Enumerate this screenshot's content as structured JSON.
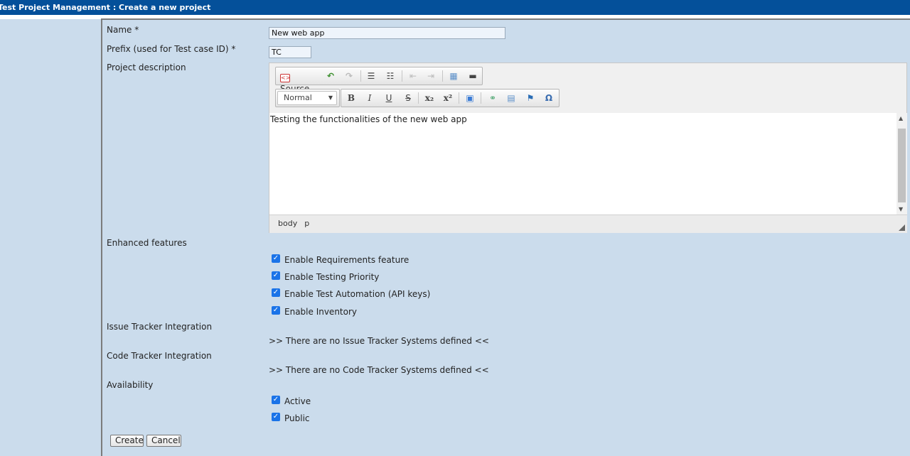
{
  "header": {
    "title": "Test Project Management : Create a new project"
  },
  "form": {
    "name_label": "Name *",
    "name_value": "New web app",
    "prefix_label": "Prefix (used for Test case ID) *",
    "prefix_value": "TC",
    "description_label": "Project description",
    "enhanced_label": "Enhanced features",
    "issue_label": "Issue Tracker Integration",
    "issue_info": ">> There are no Issue Tracker Systems defined <<",
    "code_label": "Code Tracker Integration",
    "code_info": ">> There are no Code Tracker Systems defined <<",
    "availability_label": "Availability",
    "create_label": "Create",
    "cancel_label": "Cancel"
  },
  "editor": {
    "source_label": "Source",
    "format_value": "Normal",
    "content": "Testing the functionalities of the new web app",
    "path": [
      "body",
      "p"
    ],
    "toolbar_icons": [
      "source-icon",
      "undo-icon",
      "redo-icon",
      "numbered-list-icon",
      "bullet-list-icon",
      "outdent-icon",
      "indent-icon",
      "table-icon",
      "horizontal-rule-icon",
      "bold-icon",
      "italic-icon",
      "underline-icon",
      "strikethrough-icon",
      "subscript-icon",
      "superscript-icon",
      "image-icon",
      "link-icon",
      "unlink-icon",
      "anchor-icon",
      "special-char-icon"
    ]
  },
  "enhanced_features": [
    {
      "label": "Enable Requirements feature",
      "checked": true
    },
    {
      "label": "Enable Testing Priority",
      "checked": true
    },
    {
      "label": "Enable Test Automation (API keys)",
      "checked": true
    },
    {
      "label": "Enable Inventory",
      "checked": true
    }
  ],
  "availability": [
    {
      "label": "Active",
      "checked": true
    },
    {
      "label": "Public",
      "checked": true
    }
  ],
  "colors": {
    "header_bg": "#04509a",
    "page_bg": "#cbdcec",
    "checkbox": "#1a73e8"
  }
}
